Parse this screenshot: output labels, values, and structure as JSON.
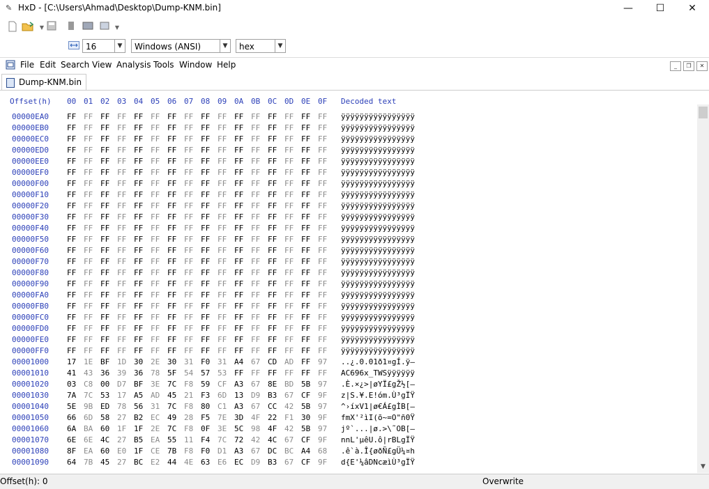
{
  "window": {
    "title": "HxD - [C:\\Users\\Ahmad\\Desktop\\Dump-KNM.bin]",
    "minimize": "—",
    "maximize": "☐",
    "close": "✕"
  },
  "toolbar": {
    "bytes_per_row": "16",
    "charset": "Windows (ANSI)",
    "offset_base": "hex"
  },
  "menu": [
    "File",
    "Edit",
    "Search",
    "View",
    "Analysis",
    "Tools",
    "Window",
    "Help"
  ],
  "tab": {
    "label": "Dump-KNM.bin"
  },
  "hex_view": {
    "header_offset": "Offset(h)",
    "header_columns": [
      "00",
      "01",
      "02",
      "03",
      "04",
      "05",
      "06",
      "07",
      "08",
      "09",
      "0A",
      "0B",
      "0C",
      "0D",
      "0E",
      "0F"
    ],
    "header_decoded": "Decoded text",
    "rows": [
      {
        "offset": "00000EA0",
        "bytes": [
          "FF",
          "FF",
          "FF",
          "FF",
          "FF",
          "FF",
          "FF",
          "FF",
          "FF",
          "FF",
          "FF",
          "FF",
          "FF",
          "FF",
          "FF",
          "FF"
        ],
        "text": "ÿÿÿÿÿÿÿÿÿÿÿÿÿÿÿÿ"
      },
      {
        "offset": "00000EB0",
        "bytes": [
          "FF",
          "FF",
          "FF",
          "FF",
          "FF",
          "FF",
          "FF",
          "FF",
          "FF",
          "FF",
          "FF",
          "FF",
          "FF",
          "FF",
          "FF",
          "FF"
        ],
        "text": "ÿÿÿÿÿÿÿÿÿÿÿÿÿÿÿÿ"
      },
      {
        "offset": "00000EC0",
        "bytes": [
          "FF",
          "FF",
          "FF",
          "FF",
          "FF",
          "FF",
          "FF",
          "FF",
          "FF",
          "FF",
          "FF",
          "FF",
          "FF",
          "FF",
          "FF",
          "FF"
        ],
        "text": "ÿÿÿÿÿÿÿÿÿÿÿÿÿÿÿÿ"
      },
      {
        "offset": "00000ED0",
        "bytes": [
          "FF",
          "FF",
          "FF",
          "FF",
          "FF",
          "FF",
          "FF",
          "FF",
          "FF",
          "FF",
          "FF",
          "FF",
          "FF",
          "FF",
          "FF",
          "FF"
        ],
        "text": "ÿÿÿÿÿÿÿÿÿÿÿÿÿÿÿÿ"
      },
      {
        "offset": "00000EE0",
        "bytes": [
          "FF",
          "FF",
          "FF",
          "FF",
          "FF",
          "FF",
          "FF",
          "FF",
          "FF",
          "FF",
          "FF",
          "FF",
          "FF",
          "FF",
          "FF",
          "FF"
        ],
        "text": "ÿÿÿÿÿÿÿÿÿÿÿÿÿÿÿÿ"
      },
      {
        "offset": "00000EF0",
        "bytes": [
          "FF",
          "FF",
          "FF",
          "FF",
          "FF",
          "FF",
          "FF",
          "FF",
          "FF",
          "FF",
          "FF",
          "FF",
          "FF",
          "FF",
          "FF",
          "FF"
        ],
        "text": "ÿÿÿÿÿÿÿÿÿÿÿÿÿÿÿÿ"
      },
      {
        "offset": "00000F00",
        "bytes": [
          "FF",
          "FF",
          "FF",
          "FF",
          "FF",
          "FF",
          "FF",
          "FF",
          "FF",
          "FF",
          "FF",
          "FF",
          "FF",
          "FF",
          "FF",
          "FF"
        ],
        "text": "ÿÿÿÿÿÿÿÿÿÿÿÿÿÿÿÿ"
      },
      {
        "offset": "00000F10",
        "bytes": [
          "FF",
          "FF",
          "FF",
          "FF",
          "FF",
          "FF",
          "FF",
          "FF",
          "FF",
          "FF",
          "FF",
          "FF",
          "FF",
          "FF",
          "FF",
          "FF"
        ],
        "text": "ÿÿÿÿÿÿÿÿÿÿÿÿÿÿÿÿ"
      },
      {
        "offset": "00000F20",
        "bytes": [
          "FF",
          "FF",
          "FF",
          "FF",
          "FF",
          "FF",
          "FF",
          "FF",
          "FF",
          "FF",
          "FF",
          "FF",
          "FF",
          "FF",
          "FF",
          "FF"
        ],
        "text": "ÿÿÿÿÿÿÿÿÿÿÿÿÿÿÿÿ"
      },
      {
        "offset": "00000F30",
        "bytes": [
          "FF",
          "FF",
          "FF",
          "FF",
          "FF",
          "FF",
          "FF",
          "FF",
          "FF",
          "FF",
          "FF",
          "FF",
          "FF",
          "FF",
          "FF",
          "FF"
        ],
        "text": "ÿÿÿÿÿÿÿÿÿÿÿÿÿÿÿÿ"
      },
      {
        "offset": "00000F40",
        "bytes": [
          "FF",
          "FF",
          "FF",
          "FF",
          "FF",
          "FF",
          "FF",
          "FF",
          "FF",
          "FF",
          "FF",
          "FF",
          "FF",
          "FF",
          "FF",
          "FF"
        ],
        "text": "ÿÿÿÿÿÿÿÿÿÿÿÿÿÿÿÿ"
      },
      {
        "offset": "00000F50",
        "bytes": [
          "FF",
          "FF",
          "FF",
          "FF",
          "FF",
          "FF",
          "FF",
          "FF",
          "FF",
          "FF",
          "FF",
          "FF",
          "FF",
          "FF",
          "FF",
          "FF"
        ],
        "text": "ÿÿÿÿÿÿÿÿÿÿÿÿÿÿÿÿ"
      },
      {
        "offset": "00000F60",
        "bytes": [
          "FF",
          "FF",
          "FF",
          "FF",
          "FF",
          "FF",
          "FF",
          "FF",
          "FF",
          "FF",
          "FF",
          "FF",
          "FF",
          "FF",
          "FF",
          "FF"
        ],
        "text": "ÿÿÿÿÿÿÿÿÿÿÿÿÿÿÿÿ"
      },
      {
        "offset": "00000F70",
        "bytes": [
          "FF",
          "FF",
          "FF",
          "FF",
          "FF",
          "FF",
          "FF",
          "FF",
          "FF",
          "FF",
          "FF",
          "FF",
          "FF",
          "FF",
          "FF",
          "FF"
        ],
        "text": "ÿÿÿÿÿÿÿÿÿÿÿÿÿÿÿÿ"
      },
      {
        "offset": "00000F80",
        "bytes": [
          "FF",
          "FF",
          "FF",
          "FF",
          "FF",
          "FF",
          "FF",
          "FF",
          "FF",
          "FF",
          "FF",
          "FF",
          "FF",
          "FF",
          "FF",
          "FF"
        ],
        "text": "ÿÿÿÿÿÿÿÿÿÿÿÿÿÿÿÿ"
      },
      {
        "offset": "00000F90",
        "bytes": [
          "FF",
          "FF",
          "FF",
          "FF",
          "FF",
          "FF",
          "FF",
          "FF",
          "FF",
          "FF",
          "FF",
          "FF",
          "FF",
          "FF",
          "FF",
          "FF"
        ],
        "text": "ÿÿÿÿÿÿÿÿÿÿÿÿÿÿÿÿ"
      },
      {
        "offset": "00000FA0",
        "bytes": [
          "FF",
          "FF",
          "FF",
          "FF",
          "FF",
          "FF",
          "FF",
          "FF",
          "FF",
          "FF",
          "FF",
          "FF",
          "FF",
          "FF",
          "FF",
          "FF"
        ],
        "text": "ÿÿÿÿÿÿÿÿÿÿÿÿÿÿÿÿ"
      },
      {
        "offset": "00000FB0",
        "bytes": [
          "FF",
          "FF",
          "FF",
          "FF",
          "FF",
          "FF",
          "FF",
          "FF",
          "FF",
          "FF",
          "FF",
          "FF",
          "FF",
          "FF",
          "FF",
          "FF"
        ],
        "text": "ÿÿÿÿÿÿÿÿÿÿÿÿÿÿÿÿ"
      },
      {
        "offset": "00000FC0",
        "bytes": [
          "FF",
          "FF",
          "FF",
          "FF",
          "FF",
          "FF",
          "FF",
          "FF",
          "FF",
          "FF",
          "FF",
          "FF",
          "FF",
          "FF",
          "FF",
          "FF"
        ],
        "text": "ÿÿÿÿÿÿÿÿÿÿÿÿÿÿÿÿ"
      },
      {
        "offset": "00000FD0",
        "bytes": [
          "FF",
          "FF",
          "FF",
          "FF",
          "FF",
          "FF",
          "FF",
          "FF",
          "FF",
          "FF",
          "FF",
          "FF",
          "FF",
          "FF",
          "FF",
          "FF"
        ],
        "text": "ÿÿÿÿÿÿÿÿÿÿÿÿÿÿÿÿ"
      },
      {
        "offset": "00000FE0",
        "bytes": [
          "FF",
          "FF",
          "FF",
          "FF",
          "FF",
          "FF",
          "FF",
          "FF",
          "FF",
          "FF",
          "FF",
          "FF",
          "FF",
          "FF",
          "FF",
          "FF"
        ],
        "text": "ÿÿÿÿÿÿÿÿÿÿÿÿÿÿÿÿ"
      },
      {
        "offset": "00000FF0",
        "bytes": [
          "FF",
          "FF",
          "FF",
          "FF",
          "FF",
          "FF",
          "FF",
          "FF",
          "FF",
          "FF",
          "FF",
          "FF",
          "FF",
          "FF",
          "FF",
          "FF"
        ],
        "text": "ÿÿÿÿÿÿÿÿÿÿÿÿÿÿÿÿ"
      },
      {
        "offset": "00001000",
        "bytes": [
          "17",
          "1E",
          "BF",
          "1D",
          "30",
          "2E",
          "30",
          "31",
          "F0",
          "31",
          "A4",
          "67",
          "CD",
          "AD",
          "FF",
          "97"
        ],
        "text": "..¿.0.01ð1¤gÍ.ÿ—"
      },
      {
        "offset": "00001010",
        "bytes": [
          "41",
          "43",
          "36",
          "39",
          "36",
          "78",
          "5F",
          "54",
          "57",
          "53",
          "FF",
          "FF",
          "FF",
          "FF",
          "FF",
          "FF"
        ],
        "text": "AC696x_TWSÿÿÿÿÿÿ"
      },
      {
        "offset": "00001020",
        "bytes": [
          "03",
          "C8",
          "00",
          "D7",
          "BF",
          "3E",
          "7C",
          "F8",
          "59",
          "CF",
          "A3",
          "67",
          "8E",
          "BD",
          "5B",
          "97"
        ],
        "text": ".È.×¿>|øYÏ£gŽ½[—"
      },
      {
        "offset": "00001030",
        "bytes": [
          "7A",
          "7C",
          "53",
          "17",
          "A5",
          "AD",
          "45",
          "21",
          "F3",
          "6D",
          "13",
          "D9",
          "B3",
          "67",
          "CF",
          "9F"
        ],
        "text": "z|S.¥.E!óm.Ù³gÏŸ"
      },
      {
        "offset": "00001040",
        "bytes": [
          "5E",
          "9B",
          "ED",
          "78",
          "56",
          "31",
          "7C",
          "F8",
          "80",
          "C1",
          "A3",
          "67",
          "CC",
          "42",
          "5B",
          "97"
        ],
        "text": "^›íxV1|ø€Á£gÌB[—"
      },
      {
        "offset": "00001050",
        "bytes": [
          "66",
          "6D",
          "58",
          "27",
          "B2",
          "EC",
          "49",
          "28",
          "F5",
          "7E",
          "3D",
          "4F",
          "22",
          "F1",
          "30",
          "9F"
        ],
        "text": "fmX'²ìI(õ~=O\"ñ0Ÿ"
      },
      {
        "offset": "00001060",
        "bytes": [
          "6A",
          "BA",
          "60",
          "1F",
          "1F",
          "2E",
          "7C",
          "F8",
          "0F",
          "3E",
          "5C",
          "98",
          "4F",
          "42",
          "5B",
          "97"
        ],
        "text": "jº`...|ø.>\\˜OB[—"
      },
      {
        "offset": "00001070",
        "bytes": [
          "6E",
          "6E",
          "4C",
          "27",
          "B5",
          "EA",
          "55",
          "11",
          "F4",
          "7C",
          "72",
          "42",
          "4C",
          "67",
          "CF",
          "9F"
        ],
        "text": "nnL'µêU.ô|rBLgÏŸ"
      },
      {
        "offset": "00001080",
        "bytes": [
          "8F",
          "EA",
          "60",
          "E0",
          "1F",
          "CE",
          "7B",
          "F8",
          "F0",
          "D1",
          "A3",
          "67",
          "DC",
          "BC",
          "A4",
          "68"
        ],
        "text": ".ê`à.Î{øðÑ£gÜ¼¤h"
      },
      {
        "offset": "00001090",
        "bytes": [
          "64",
          "7B",
          "45",
          "27",
          "BC",
          "E2",
          "44",
          "4E",
          "63",
          "E6",
          "EC",
          "D9",
          "B3",
          "67",
          "CF",
          "9F"
        ],
        "text": "d{E'¼âDNcæìÙ³gÏŸ"
      }
    ]
  },
  "scrollbar": {
    "up": "▲",
    "down": "▼"
  },
  "status": {
    "offset": "Offset(h): 0",
    "mode": "Overwrite"
  }
}
